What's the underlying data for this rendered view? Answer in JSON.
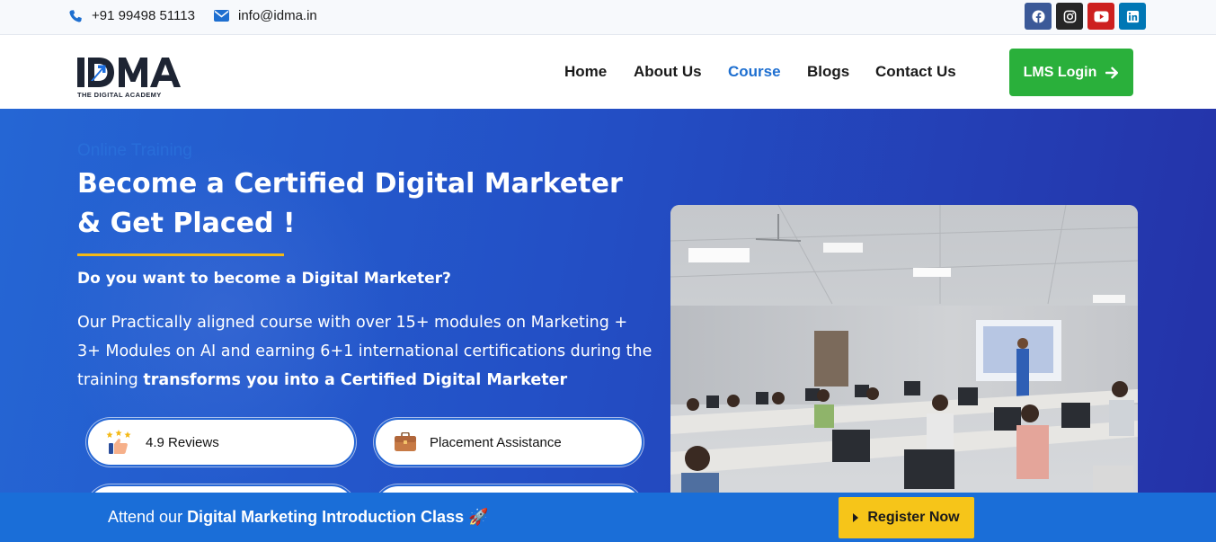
{
  "topbar": {
    "phone": "+91 99498 51113",
    "email": "info@idma.in",
    "socials": [
      "facebook-icon",
      "instagram-icon",
      "youtube-icon",
      "linkedin-icon"
    ]
  },
  "header": {
    "logo_text": "IDMA",
    "logo_tagline": "THE DIGITAL ACADEMY",
    "nav": [
      {
        "label": "Home"
      },
      {
        "label": "About Us"
      },
      {
        "label": "Course",
        "active": true
      },
      {
        "label": "Blogs"
      },
      {
        "label": "Contact Us"
      }
    ],
    "lms_button": "LMS Login"
  },
  "hero": {
    "eyebrow": "Online Training",
    "title": "Become a Certified Digital Marketer & Get Placed !",
    "subtitle": "Do you want to become a Digital Marketer?",
    "body_plain": "Our Practically aligned course with over 15+ modules on Marketing + 3+ Modules on AI and earning 6+1 international certifications during the training ",
    "body_bold": "transforms you into a Certified Digital Marketer",
    "features": [
      {
        "label": "4.9 Reviews",
        "icon": "reviews-thumbs-up-icon"
      },
      {
        "label": "Placement Assistance",
        "icon": "briefcase-icon"
      }
    ]
  },
  "banner": {
    "text_plain": "Attend our ",
    "text_bold": "Digital Marketing Introduction Class",
    "emoji": "🚀",
    "register_button": "Register Now"
  },
  "colors": {
    "brand_blue": "#1e6fd0",
    "hero_start": "#2566d4",
    "hero_end": "#2432a8",
    "lms_green": "#2ab03b",
    "cta_yellow": "#f6c519",
    "underline_gold": "#f4b916"
  }
}
